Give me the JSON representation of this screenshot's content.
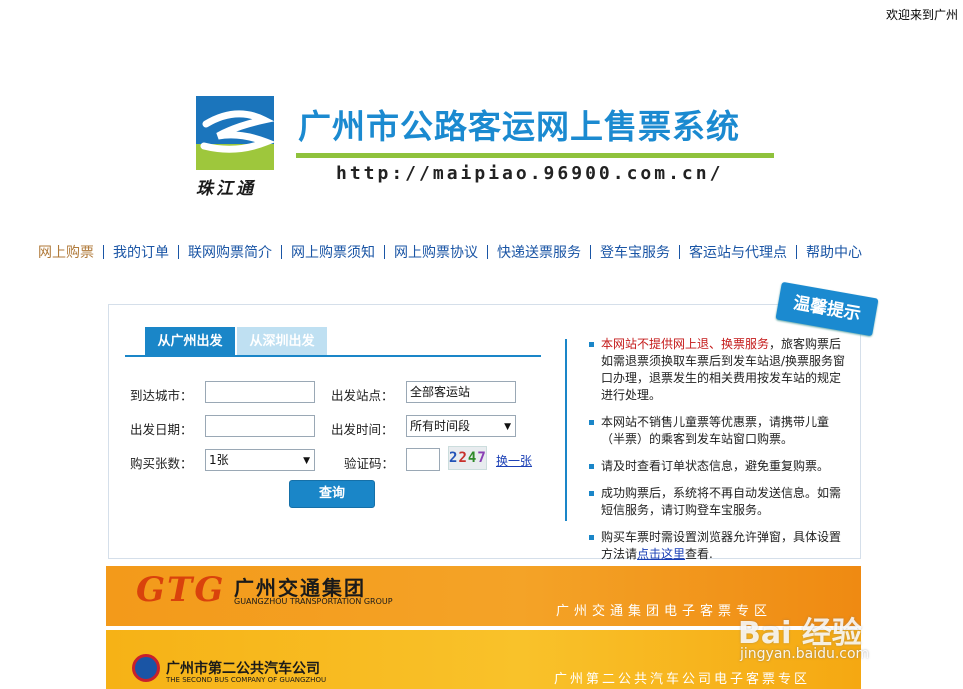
{
  "header": {
    "welcome": "欢迎来到广州",
    "logo_text": "珠江通",
    "site_title": "广州市公路客运网上售票系统",
    "site_url": "http://maipiao.96900.com.cn/"
  },
  "nav": [
    {
      "label": "网上购票",
      "active": true
    },
    {
      "label": "我的订单"
    },
    {
      "label": "联网购票简介"
    },
    {
      "label": "网上购票须知"
    },
    {
      "label": "网上购票协议"
    },
    {
      "label": "快递送票服务"
    },
    {
      "label": "登车宝服务"
    },
    {
      "label": "客运站与代理点"
    },
    {
      "label": "帮助中心"
    }
  ],
  "search": {
    "tabs": [
      "从广州出发",
      "从深圳出发"
    ],
    "arrival_city_label": "到达城市：",
    "arrival_city_value": "",
    "departure_station_label": "出发站点：",
    "departure_station_value": "全部客运站",
    "departure_date_label": "出发日期：",
    "departure_date_value": "",
    "departure_time_label": "出发时间：",
    "departure_time_value": "所有时间段",
    "ticket_count_label": "购买张数：",
    "ticket_count_value": "1张",
    "captcha_label": "验证码：",
    "captcha_input": "",
    "captcha_chars": [
      "2",
      "2",
      "4",
      "7"
    ],
    "refresh_label": "换一张",
    "query_label": "查询"
  },
  "tips_badge": "温馨提示",
  "tips": {
    "t1_red": "本网站不提供网上退、换票服务",
    "t1_rest": "，旅客购票后如需退票须换取车票后到发车站退/换票服务窗口办理，退票发生的相关费用按发车站的规定进行处理。",
    "t2": "本网站不销售儿童票等优惠票，请携带儿童（半票）的乘客到发车站窗口购票。",
    "t3": "请及时查看订单状态信息，避免重复购票。",
    "t4": "成功购票后，系统将不再自动发送信息。如需短信服务，请订购登车宝服务。",
    "t5_pre": "购买车票时需设置浏览器允许弹窗，具体设置方法请",
    "t5_link": "点击这里",
    "t5_post": "查看."
  },
  "banners": {
    "b1_logo": "GTG",
    "b1_cn": "广州交通集团",
    "b1_en": "GUANGZHOU TRANSPORTATION GROUP",
    "b1_zone": "广州交通集团电子客票专区",
    "b2_cn": "广州市第二公共汽车公司",
    "b2_en": "THE SECOND BUS COMPANY OF GUANGZHOU",
    "b2_zone": "广州第二公共汽车公司电子客票专区"
  },
  "watermark": {
    "text": "Bai 经验",
    "url": "jingyan.baidu.com"
  },
  "colors": {
    "brand_blue": "#1a86c8",
    "nav_blue": "#1a55a5",
    "active_nav": "#b07a3a",
    "logo_green": "#9ec73c",
    "notice_red": "#c41a1a"
  }
}
